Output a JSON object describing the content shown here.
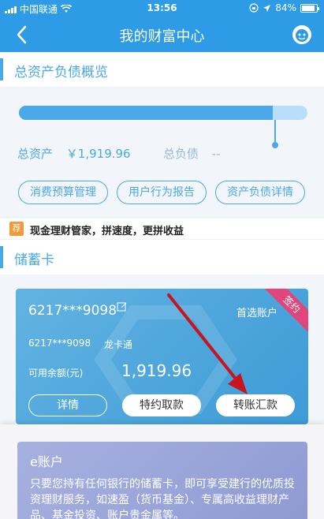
{
  "status_bar": {
    "carrier": "中国联通",
    "time": "13:56",
    "battery": "84%"
  },
  "nav": {
    "title": "我的财富中心"
  },
  "overview": {
    "section_title": "总资产负债概览",
    "asset_ratio": 0.88,
    "total_assets_label": "总资产",
    "total_assets_value": "￥1,919.96",
    "total_debt_label": "总负债",
    "total_debt_value": "--",
    "buttons": [
      "消费预算管理",
      "用户行为报告",
      "资产负债详情"
    ]
  },
  "ticker": {
    "badge": "荐",
    "text": "现金理财管家，拼速度，更拼收益"
  },
  "debit": {
    "section_title": "储蓄卡",
    "card": {
      "number": "6217***9098",
      "preferred_label": "首选账户",
      "ribbon": "签约",
      "sub_number": "6217***9098",
      "sub_name": "龙卡通",
      "balance_label": "可用余额(元)",
      "balance_value": "1,919.96",
      "buttons": [
        "详情",
        "特约取款",
        "转账汇款"
      ]
    }
  },
  "eaccount": {
    "title": "e账户",
    "desc": "只要您持有任何银行的储蓄卡，即可享受建行的优质投资理财服务，如速盈（货币基金）、专属高收益理财产品、基金投资、账户贵金属等。"
  },
  "colors": {
    "brand": "#2e9be6",
    "accent": "#4aa8e8",
    "ribbon": "#e0457b",
    "badge": "#f29a38",
    "arrow": "#c8141e"
  }
}
